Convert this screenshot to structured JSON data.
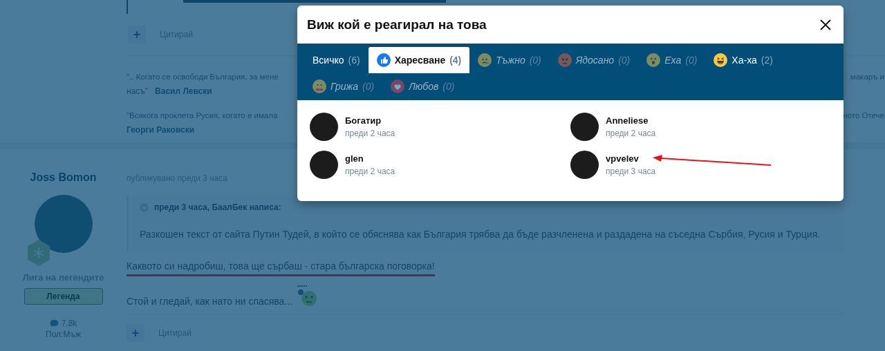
{
  "top_post": {
    "actions": {
      "add": "+",
      "quote": "Цитирай"
    }
  },
  "signature": [
    {
      "text": "\".. Когато се освободи България, за мене",
      "tail": "макаръ и",
      "continuation": "насъ\"",
      "author": "Васил Левски"
    },
    {
      "text": "\"Всякога проклета Русия, когато е имала",
      "tail": "ното Отече",
      "author": "Георги Раковски"
    }
  ],
  "post": {
    "author": {
      "name": "Joss Bomon",
      "group": "Лига на легендите",
      "rank": "Легенда",
      "posts": "7,8k",
      "gender": "Пол:Мъж"
    },
    "meta": "публикувано преди 3 часа",
    "quote": {
      "header": "преди 3 часа, БаалБек написа:",
      "text": "Разкошен текст от сайта Путин Тудей, в който се обяснява как България трябва да бъде разчленена и раздадена на съседна Сърбия, Русия и Турция."
    },
    "paragraphs": [
      {
        "text": "Каквото си надробиш, това ще сърбаш - стара българска поговорка!",
        "underlined": true
      },
      {
        "text": "Стой и гледай, как нато ни спасява...",
        "underlined": false
      }
    ],
    "actions": {
      "add": "+",
      "quote": "Цитирай"
    }
  },
  "modal": {
    "title": "Виж кой е реагирал на това",
    "tabs": [
      {
        "kind": "all",
        "label": "Всичко",
        "count": "(6)",
        "selected": false,
        "disabled": false
      },
      {
        "kind": "like",
        "label": "Харесване",
        "count": "(4)",
        "selected": true,
        "disabled": false
      },
      {
        "kind": "sad",
        "label": "Тъжно",
        "count": "(0)",
        "selected": false,
        "disabled": true
      },
      {
        "kind": "angry",
        "label": "Ядосано",
        "count": "(0)",
        "selected": false,
        "disabled": true
      },
      {
        "kind": "wow",
        "label": "Еха",
        "count": "(0)",
        "selected": false,
        "disabled": true
      },
      {
        "kind": "haha",
        "label": "Ха-ха",
        "count": "(2)",
        "selected": false,
        "disabled": false
      },
      {
        "kind": "care",
        "label": "Грижа",
        "count": "(0)",
        "selected": false,
        "disabled": true
      },
      {
        "kind": "love",
        "label": "Любов",
        "count": "(0)",
        "selected": false,
        "disabled": true
      }
    ],
    "users": [
      {
        "name": "Богатир",
        "time": "преди 2 часа"
      },
      {
        "name": "Anneliese",
        "time": "преди 2 часа"
      },
      {
        "name": "glen",
        "time": "преди 2 часа"
      },
      {
        "name": "vpvelev",
        "time": "преди 3 часа"
      }
    ]
  }
}
